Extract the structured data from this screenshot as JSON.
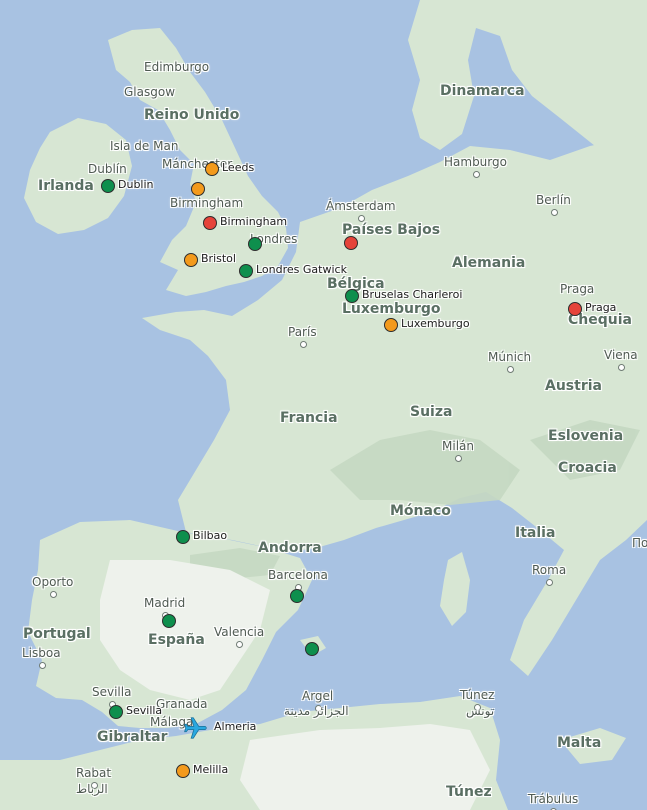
{
  "colors": {
    "sea": "#a8c2e2",
    "land": "#d7e6d3",
    "green": "#0e8f4d",
    "orange": "#f39a1c",
    "red": "#e5433a",
    "plane": "#29a8e0"
  },
  "countries": [
    {
      "id": "reino-unido",
      "label": "Reino Unido"
    },
    {
      "id": "irlanda",
      "label": "Irlanda"
    },
    {
      "id": "dinamarca",
      "label": "Dinamarca"
    },
    {
      "id": "paises-bajos",
      "label": "Países Bajos"
    },
    {
      "id": "alemania",
      "label": "Alemania"
    },
    {
      "id": "belgica",
      "label": "Bélgica"
    },
    {
      "id": "luxemburgo",
      "label": "Luxemburgo"
    },
    {
      "id": "chequia",
      "label": "Chequia"
    },
    {
      "id": "austria",
      "label": "Austria"
    },
    {
      "id": "francia",
      "label": "Francia"
    },
    {
      "id": "suiza",
      "label": "Suiza"
    },
    {
      "id": "eslovenia",
      "label": "Eslovenia"
    },
    {
      "id": "croacia",
      "label": "Croacia"
    },
    {
      "id": "monaco",
      "label": "Mónaco"
    },
    {
      "id": "italia",
      "label": "Italia"
    },
    {
      "id": "andorra",
      "label": "Andorra"
    },
    {
      "id": "portugal",
      "label": "Portugal"
    },
    {
      "id": "espana",
      "label": "España"
    },
    {
      "id": "gibraltar",
      "label": "Gibraltar"
    },
    {
      "id": "malta",
      "label": "Malta"
    },
    {
      "id": "tunez",
      "label": "Túnez"
    }
  ],
  "cities": [
    {
      "id": "edimburgo",
      "label": "Edimburgo"
    },
    {
      "id": "glasgow",
      "label": "Glasgow"
    },
    {
      "id": "isla-de-man",
      "label": "Isla de Man"
    },
    {
      "id": "dublin",
      "label": "Dublín"
    },
    {
      "id": "manchester",
      "label": "Mánchester"
    },
    {
      "id": "birmingham",
      "label": "Birmingham"
    },
    {
      "id": "londres",
      "label": "Londres"
    },
    {
      "id": "hamburgo",
      "label": "Hamburgo"
    },
    {
      "id": "amsterdam",
      "label": "Ámsterdam"
    },
    {
      "id": "berlin",
      "label": "Berlín"
    },
    {
      "id": "praga",
      "label": "Praga"
    },
    {
      "id": "paris",
      "label": "París"
    },
    {
      "id": "munich",
      "label": "Múnich"
    },
    {
      "id": "viena",
      "label": "Viena"
    },
    {
      "id": "milan",
      "label": "Milán"
    },
    {
      "id": "roma",
      "label": "Roma"
    },
    {
      "id": "oporto",
      "label": "Oporto"
    },
    {
      "id": "madrid",
      "label": "Madrid"
    },
    {
      "id": "valencia",
      "label": "Valencia"
    },
    {
      "id": "barcelona",
      "label": "Barcelona"
    },
    {
      "id": "lisboa",
      "label": "Lisboa"
    },
    {
      "id": "sevilla",
      "label": "Sevilla"
    },
    {
      "id": "granada",
      "label": "Granada"
    },
    {
      "id": "malaga",
      "label": "Málaga"
    },
    {
      "id": "argel",
      "label": "Argel"
    },
    {
      "id": "argel-ar",
      "label": "الجزائر مدينة"
    },
    {
      "id": "tunez-city",
      "label": "Túnez"
    },
    {
      "id": "tunez-ar",
      "label": "تونس"
    },
    {
      "id": "rabat",
      "label": "Rabat"
    },
    {
      "id": "rabat-ar",
      "label": "الرباط"
    },
    {
      "id": "trabulus",
      "label": "Trábulus"
    },
    {
      "id": "podgorica-cut",
      "label": "Подг"
    }
  ],
  "markers": [
    {
      "id": "dublin",
      "label": "Dublin",
      "status": "green"
    },
    {
      "id": "leeds",
      "label": "Leeds",
      "status": "orange"
    },
    {
      "id": "manchester",
      "label": "",
      "status": "orange"
    },
    {
      "id": "birmingham",
      "label": "Birmingham",
      "status": "red"
    },
    {
      "id": "londres",
      "label": "",
      "status": "green"
    },
    {
      "id": "bristol",
      "label": "Bristol",
      "status": "orange"
    },
    {
      "id": "londres-gatwick",
      "label": "Londres Gatwick",
      "status": "green"
    },
    {
      "id": "amsterdam",
      "label": "",
      "status": "red"
    },
    {
      "id": "bruselas-charleroi",
      "label": "Bruselas Charleroi",
      "status": "green"
    },
    {
      "id": "luxemburgo",
      "label": "Luxemburgo",
      "status": "orange"
    },
    {
      "id": "praga",
      "label": "Praga",
      "status": "red"
    },
    {
      "id": "bilbao",
      "label": "Bilbao",
      "status": "green"
    },
    {
      "id": "barcelona",
      "label": "",
      "status": "green"
    },
    {
      "id": "madrid",
      "label": "",
      "status": "green"
    },
    {
      "id": "ibiza",
      "label": "",
      "status": "green"
    },
    {
      "id": "sevilla",
      "label": "Sevilla",
      "status": "green"
    },
    {
      "id": "melilla",
      "label": "Melilla",
      "status": "orange"
    }
  ],
  "origin": {
    "id": "almeria",
    "label": "Almeria",
    "icon": "airplane-icon"
  }
}
